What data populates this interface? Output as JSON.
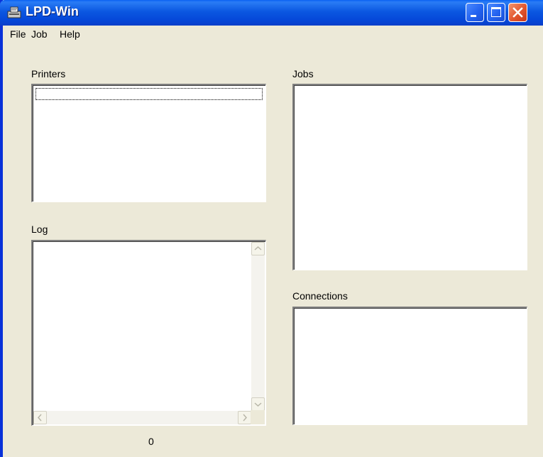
{
  "window": {
    "title": "LPD-Win"
  },
  "menu": {
    "file": "File",
    "job": "Job",
    "help": "Help"
  },
  "panels": {
    "printers_label": "Printers",
    "jobs_label": "Jobs",
    "log_label": "Log",
    "connections_label": "Connections"
  },
  "status": {
    "count": "0"
  },
  "icons": {
    "app": "printer-icon",
    "minimize": "minimize-icon",
    "maximize": "maximize-icon",
    "close": "close-icon",
    "scroll_up": "chevron-up-icon",
    "scroll_down": "chevron-down-icon",
    "scroll_left": "chevron-left-icon",
    "scroll_right": "chevron-right-icon"
  },
  "colors": {
    "titlebar": "#0A57E1",
    "face": "#ECE9D8",
    "close": "#E2562E"
  }
}
